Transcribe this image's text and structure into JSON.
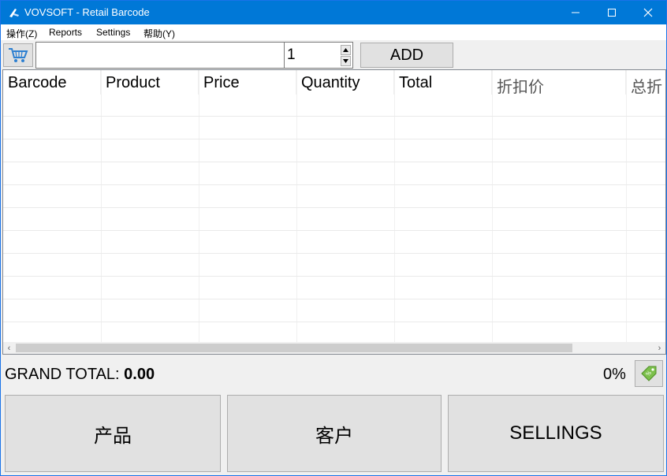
{
  "window": {
    "title": "VOVSOFT - Retail Barcode",
    "icons": [
      "app-icon",
      "minimize-icon",
      "maximize-icon",
      "close-icon"
    ]
  },
  "menu": {
    "items": [
      "操作(Z)",
      "Reports",
      "Settings",
      "帮助(Y)"
    ]
  },
  "toolbar": {
    "barcode_value": "",
    "quantity": "1",
    "add_label": "ADD",
    "cart_icon": "cart-icon"
  },
  "grid": {
    "columns": [
      "Barcode",
      "Product",
      "Price",
      "Quantity",
      "Total",
      "折扣价",
      "总折"
    ],
    "rows": []
  },
  "footer": {
    "grand_total_label": "GRAND TOTAL:",
    "grand_total_value": "0.00",
    "discount_percent": "0%",
    "discount_icon": "tag-icon"
  },
  "buttons": {
    "products": "产品",
    "customers": "客户",
    "sellings": "SELLINGS"
  },
  "colors": {
    "titlebar": "#0078d7",
    "accent_icon": "#4a90d9",
    "tag_green": "#7cc04b"
  }
}
